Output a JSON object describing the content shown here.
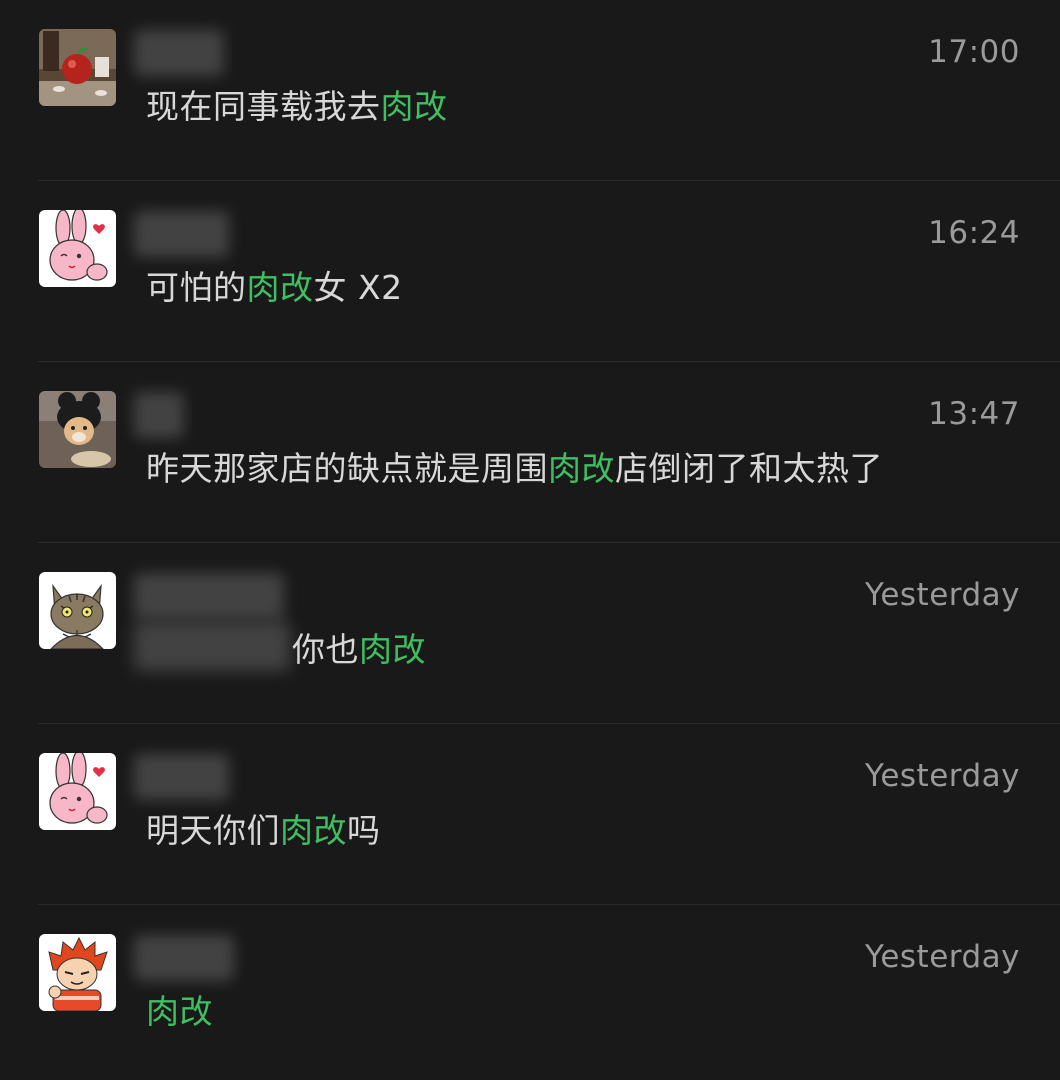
{
  "colors": {
    "background": "#191919",
    "primary_text": "#d8d8d8",
    "secondary_text": "#9a9a9a",
    "highlight": "#3fbf62",
    "divider": "#2c2c2c"
  },
  "chats": [
    {
      "avatar_icon": "apple-photo-avatar",
      "time": "17:00",
      "preview": {
        "before": "现在同事载我去",
        "highlight": "肉改",
        "after": ""
      }
    },
    {
      "avatar_icon": "pink-bunny-avatar",
      "time": "16:24",
      "preview": {
        "before": "可怕的",
        "highlight": "肉改",
        "after": "女 X2"
      }
    },
    {
      "avatar_icon": "dog-hat-avatar",
      "time": "13:47",
      "preview": {
        "before": "昨天那家店的缺点就是周围",
        "highlight": "肉改",
        "after": "店倒闭了和太热了"
      }
    },
    {
      "avatar_icon": "tabby-cat-avatar",
      "time": "Yesterday",
      "preview": {
        "before": "你也",
        "highlight": "肉改",
        "after": ""
      }
    },
    {
      "avatar_icon": "pink-bunny-avatar",
      "time": "Yesterday",
      "preview": {
        "before": "明天你们",
        "highlight": "肉改",
        "after": "吗"
      }
    },
    {
      "avatar_icon": "red-hair-boy-avatar",
      "time": "Yesterday",
      "preview": {
        "before": "",
        "highlight": "肉改",
        "after": ""
      }
    }
  ]
}
